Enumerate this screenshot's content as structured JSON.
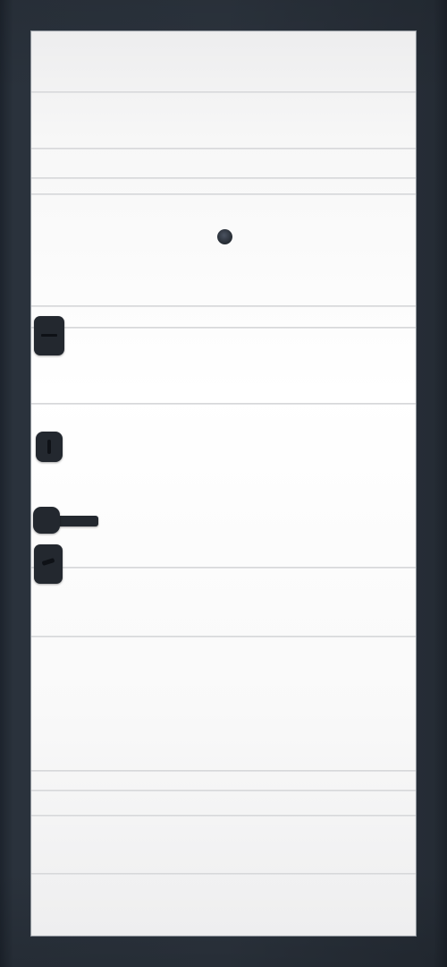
{
  "image": {
    "subject": "",
    "colors": {
      "frame": "#2c343e",
      "panel": "#ffffff",
      "hardware": "#23282f",
      "groove": "#d9dadc"
    },
    "hardware_icons": [
      "peephole-icon",
      "upper-lock-plate-icon",
      "cylinder-lock-icon",
      "lever-handle-icon",
      "lower-lock-plate-icon"
    ]
  }
}
